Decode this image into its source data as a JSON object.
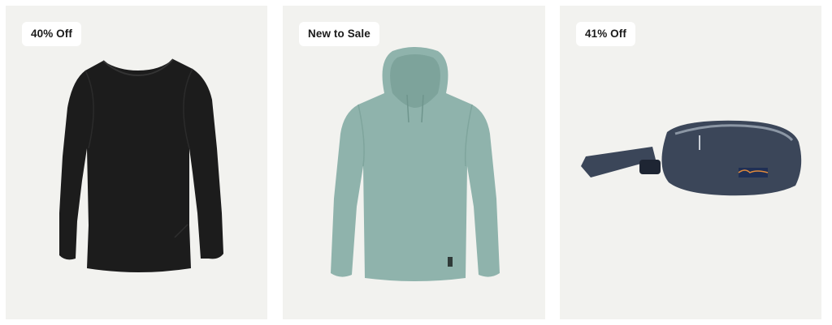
{
  "products": [
    {
      "badge": "40% Off",
      "image_icon": "black-long-sleeve-shirt-icon",
      "color": "#1c1c1c"
    },
    {
      "badge": "New to Sale",
      "image_icon": "sage-hoodie-icon",
      "color": "#8fb3ac"
    },
    {
      "badge": "41% Off",
      "image_icon": "navy-hip-pack-icon",
      "color": "#3b4659"
    }
  ],
  "colors": {
    "card_background": "#f2f2ef",
    "badge_background": "#ffffff"
  }
}
